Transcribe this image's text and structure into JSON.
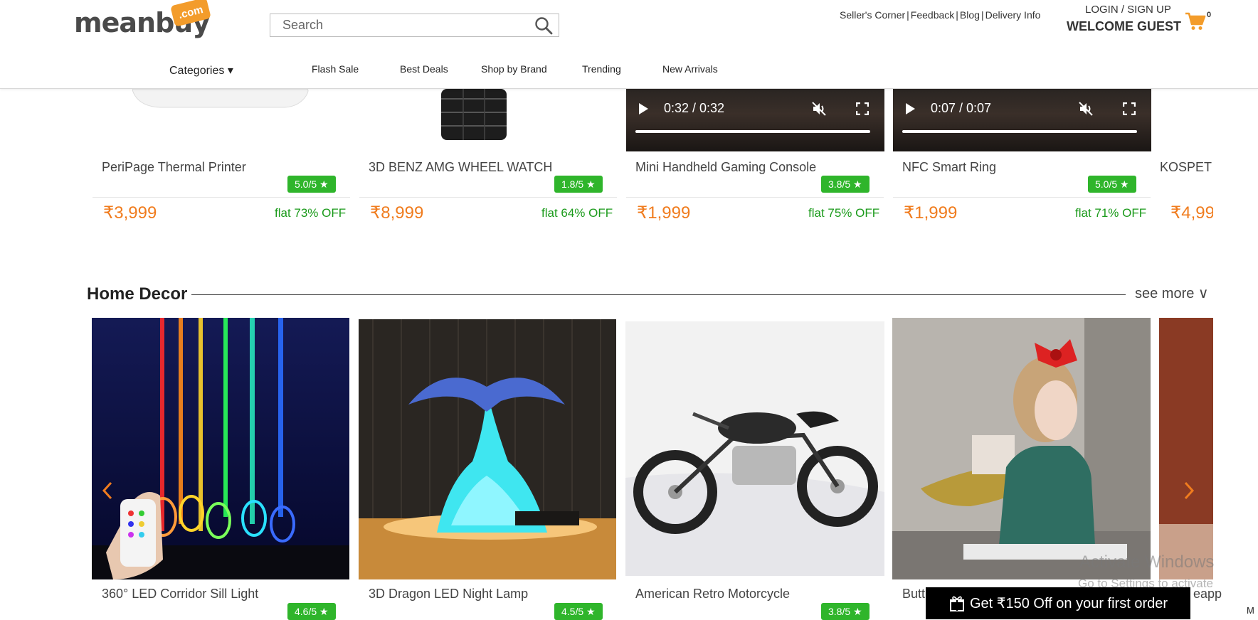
{
  "header": {
    "logo_text": "meanbuy",
    "logo_tag": ".com",
    "search_placeholder": "Search",
    "links": [
      "Seller's Corner",
      "Feedback",
      "Blog",
      "Delivery Info"
    ],
    "login": "LOGIN / SIGN UP",
    "welcome": "WELCOME GUEST",
    "cart_count": "0",
    "categories_label": "Categories ▾",
    "nav": [
      "Flash Sale",
      "Best Deals",
      "Shop by Brand",
      "Trending",
      "New Arrivals"
    ]
  },
  "top_products": [
    {
      "name": "PeriPage Thermal Printer",
      "rating": "5.0/5 ★",
      "price": "₹3,999",
      "off": "flat 73% OFF"
    },
    {
      "name": "3D BENZ AMG WHEEL WATCH",
      "rating": "1.8/5 ★",
      "price": "₹8,999",
      "off": "flat 64% OFF"
    },
    {
      "name": "Mini Handheld Gaming Console",
      "rating": "3.8/5 ★",
      "price": "₹1,999",
      "off": "flat 75% OFF",
      "video_time": "0:32 / 0:32"
    },
    {
      "name": "NFC Smart Ring",
      "rating": "5.0/5 ★",
      "price": "₹1,999",
      "off": "flat 71% OFF",
      "video_time": "0:07 / 0:07"
    },
    {
      "name": "KOSPET",
      "price": "₹4,99"
    }
  ],
  "home_decor": {
    "title": "Home Decor",
    "see_more": "see more ∨",
    "items": [
      {
        "name": "360° LED Corridor Sill Light",
        "rating": "4.6/5 ★"
      },
      {
        "name": "3D Dragon LED Night Lamp",
        "rating": "4.5/5 ★"
      },
      {
        "name": "American Retro Motorcycle",
        "rating": "3.8/5 ★"
      },
      {
        "name": "Butt",
        "name_tail": "eapp"
      }
    ]
  },
  "promo": {
    "text": "Get ₹150 Off on your first order"
  },
  "watermark": {
    "line1": "Activate Windows",
    "line2": "Go to Settings to activate Windows."
  },
  "edge_text": "M"
}
